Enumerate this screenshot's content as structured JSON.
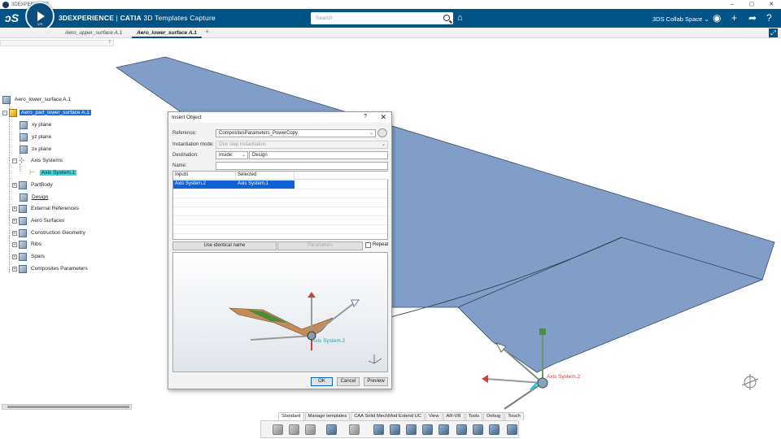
{
  "window": {
    "title": "3DEXPERIENCE",
    "minimize": "–",
    "maximize": "▢",
    "close": "✕"
  },
  "header": {
    "compass_version": "V,R",
    "brand_bold": "3DEXPERIENCE",
    "brand_sep": " | ",
    "brand_app": "CATIA",
    "brand_sub": " 3D Templates Capture",
    "search_placeholder": "Search",
    "collab_space": "3DS Collab Space ⌄"
  },
  "tabs": [
    {
      "label": "Aero_upper_surface A.1"
    },
    {
      "label": "Aero_lower_surface A.1"
    }
  ],
  "tab_plus": "+",
  "tree": {
    "collapse_glyph": "‹",
    "items": [
      {
        "label": "Aero_lower_surface A.1"
      },
      {
        "label": "Aero_part_lower_surface A.1"
      },
      {
        "label": "xy plane"
      },
      {
        "label": "yz plane"
      },
      {
        "label": "zx plane"
      },
      {
        "label": "Axis Systems"
      },
      {
        "label": "Axis System.1"
      },
      {
        "label": "PartBody"
      },
      {
        "label": "Design"
      },
      {
        "label": "External References"
      },
      {
        "label": "Aero Surfaces"
      },
      {
        "label": "Construction Geometry"
      },
      {
        "label": "Ribs"
      },
      {
        "label": "Spars"
      },
      {
        "label": "Composites Parameters"
      }
    ]
  },
  "viewport": {
    "axis_label": "Axis System.2"
  },
  "dialog": {
    "title": "Insert Object",
    "help": "?",
    "close": "✕",
    "reference_label": "Reference:",
    "reference_value": "CompositesParameters_PowerCopy",
    "mode_label": "Instantiation mode:",
    "mode_value": "One step instantiation",
    "destination_label": "Destination:",
    "destination_type": "Inside:",
    "destination_value": "Design",
    "name_label": "Name:",
    "name_value": "",
    "table_headers": [
      "Inputs",
      "Selected"
    ],
    "table_rows": [
      {
        "input": "Axis System.2",
        "selected": "Axis System.1"
      }
    ],
    "use_identical_name": "Use identical name",
    "parameters": "Parameters",
    "repeat": "Repeat",
    "preview_label": "Axis System.2",
    "ok": "OK",
    "cancel": "Cancel",
    "preview": "Preview"
  },
  "bottom_tabs": [
    "Standard",
    "Manage templates",
    "CAA Solid MechMod Extend UC",
    "View",
    "AR-VR",
    "Tools",
    "Debug",
    "Touch"
  ]
}
